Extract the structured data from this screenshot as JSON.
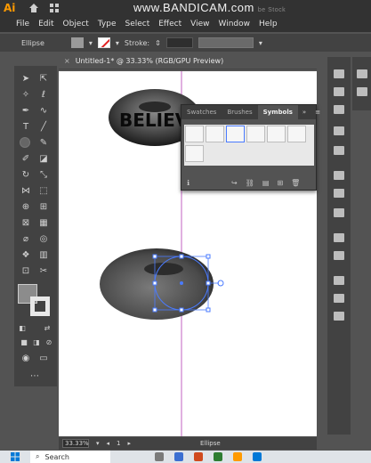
{
  "watermark": {
    "text": "www.BANDICAM.com",
    "suffix": "be Stock"
  },
  "app": {
    "logo": "Ai"
  },
  "menu": [
    "File",
    "Edit",
    "Object",
    "Type",
    "Select",
    "Effect",
    "View",
    "Window",
    "Help"
  ],
  "controlbar": {
    "object_label": "Ellipse",
    "stroke_label": "Stroke:"
  },
  "document": {
    "tab_title": "Untitled-1* @ 33.33% (RGB/GPU Preview)",
    "close": "×"
  },
  "artwork": {
    "text_on_torus": "BELIEV"
  },
  "symbols_panel": {
    "tabs": [
      "Swatches",
      "Brushes",
      "Symbols"
    ],
    "active_tab": "Symbols",
    "menu_glyph": "≡",
    "collapse_glyph": "»"
  },
  "statusbar": {
    "zoom": "33.33%",
    "artboard": "1",
    "tool": "Ellipse"
  },
  "taskbar": {
    "search_placeholder": "Search"
  },
  "colors": {
    "menubar": "#323232",
    "panel": "#535353",
    "selection": "#4a7bff",
    "guide": "#c060c0",
    "ai_orange": "#ff9a00"
  }
}
